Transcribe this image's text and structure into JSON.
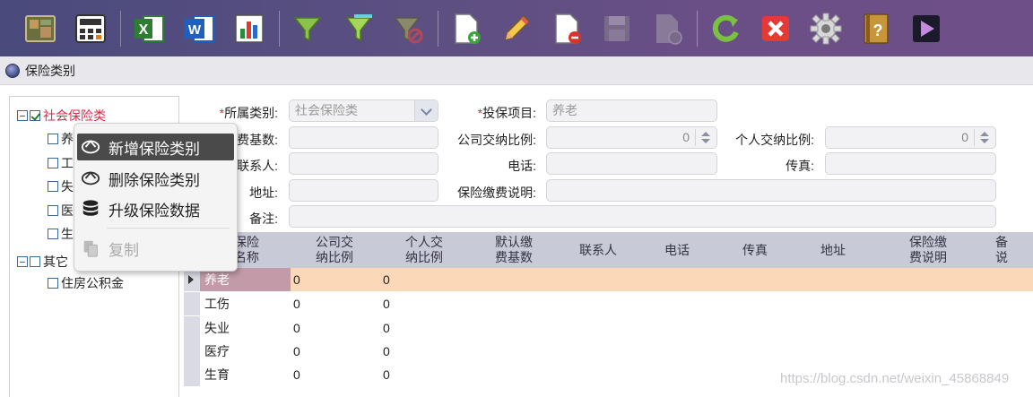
{
  "toolbar": {
    "buttons": [
      {
        "name": "board-icon"
      },
      {
        "name": "calculator-icon"
      },
      {
        "name": "excel-icon"
      },
      {
        "name": "word-icon"
      },
      {
        "name": "chart-icon"
      },
      {
        "name": "filter-icon"
      },
      {
        "name": "filter-add-icon"
      },
      {
        "name": "filter-clear-icon"
      },
      {
        "name": "new-doc-icon"
      },
      {
        "name": "edit-icon"
      },
      {
        "name": "delete-doc-icon"
      },
      {
        "name": "save-icon"
      },
      {
        "name": "copy-doc-icon"
      },
      {
        "name": "refresh-icon"
      },
      {
        "name": "close-icon"
      },
      {
        "name": "gear-icon"
      },
      {
        "name": "help-icon"
      },
      {
        "name": "play-icon"
      }
    ]
  },
  "titlebar": {
    "title": "保险类别"
  },
  "tree": {
    "root1": "社会保险类",
    "root1_children": [
      "养",
      "工",
      "失",
      "医",
      "生"
    ],
    "root2": "其它",
    "root2_child": "住房公积金"
  },
  "context_menu": {
    "items": [
      "新增保险类别",
      "删除保险类别",
      "升级保险数据",
      "复制"
    ]
  },
  "form": {
    "category_label": "所属类别:",
    "category_value": "社会保险类",
    "insured_item_label": "投保项目:",
    "insured_item_value": "养老",
    "base_label": "费基数:",
    "company_ratio_label": "公司交纳比例:",
    "company_ratio_value": "0",
    "personal_ratio_label": "个人交纳比例:",
    "personal_ratio_value": "0",
    "contact_label": "联系人:",
    "phone_label": "电话:",
    "fax_label": "传真:",
    "address_label": "地址:",
    "payment_desc_label": "保险缴费说明:",
    "remark_label": "备注:",
    "required_mark": "*"
  },
  "grid": {
    "headers": [
      "保险\n名称",
      "公司交\n纳比例",
      "个人交\n纳比例",
      "默认缴\n费基数",
      "联系人",
      "电话",
      "传真",
      "地址",
      "保险缴\n费说明",
      "备\n说"
    ],
    "rows": [
      {
        "name": "养老",
        "company": "0",
        "personal": "0"
      },
      {
        "name": "工伤",
        "company": "0",
        "personal": "0"
      },
      {
        "name": "失业",
        "company": "0",
        "personal": "0"
      },
      {
        "name": "医疗",
        "company": "0",
        "personal": "0"
      },
      {
        "name": "生育",
        "company": "0",
        "personal": "0"
      }
    ]
  },
  "watermark": "https://blog.csdn.net/weixin_45868849"
}
